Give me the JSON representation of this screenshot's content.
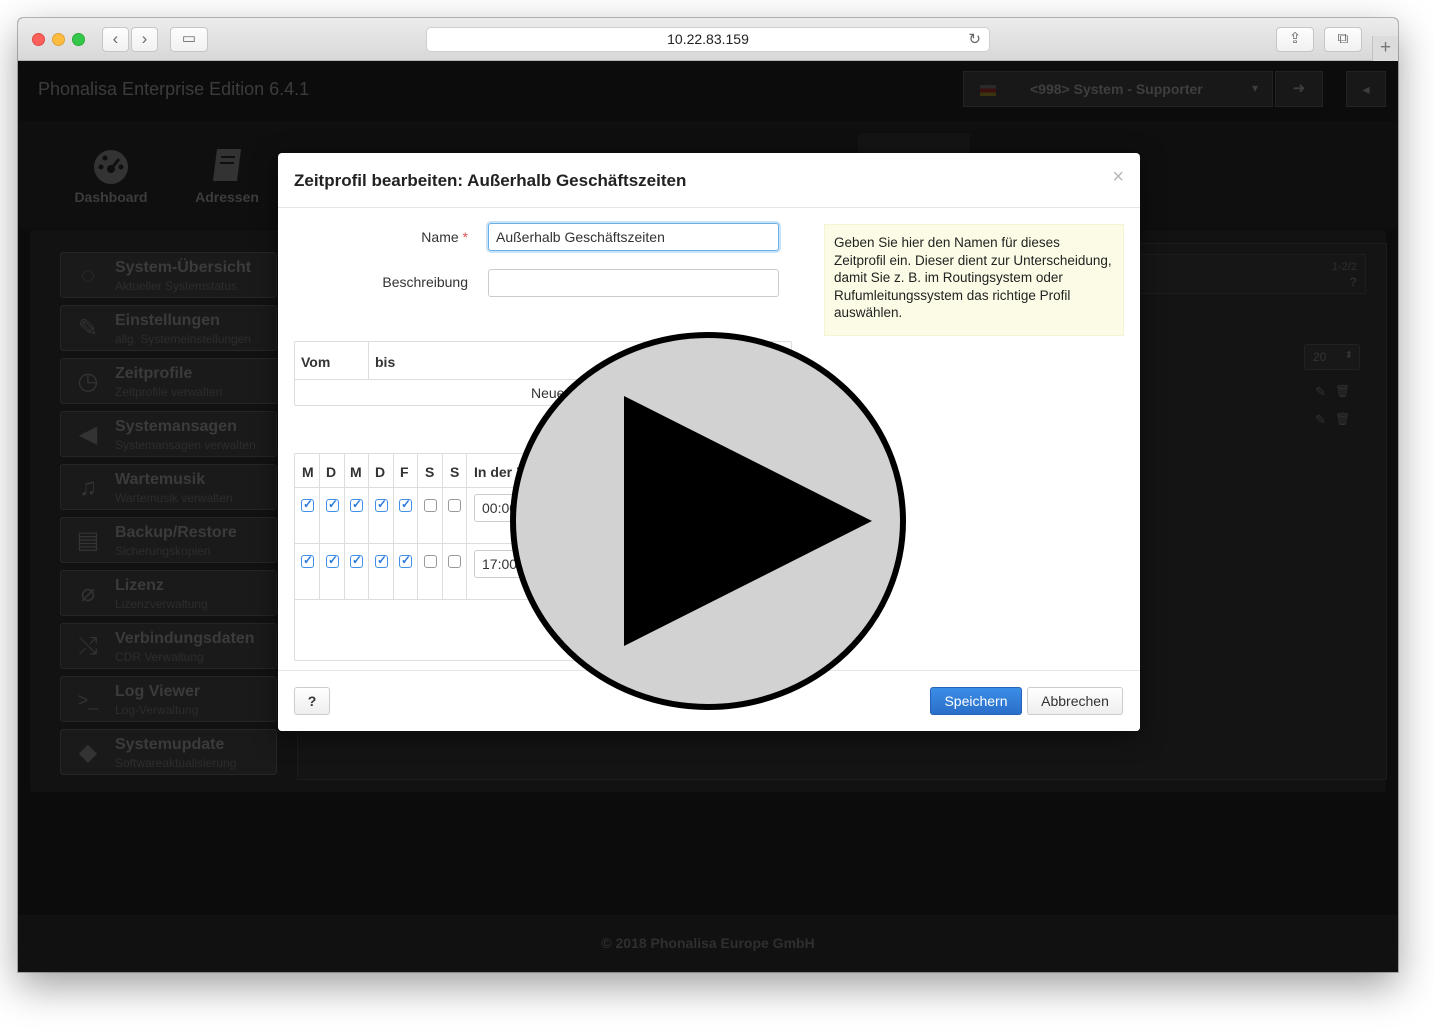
{
  "browser": {
    "url": "10.22.83.159",
    "back_glyph": "‹",
    "forward_glyph": "›",
    "sidebar_glyph": "▭",
    "reload_glyph": "↻",
    "share_glyph": "⇪",
    "tabs_glyph": "⧉",
    "newtab_glyph": "+"
  },
  "app": {
    "title": "Phonalisa Enterprise Edition 6.4.1",
    "user": "<998> System - Supporter",
    "user_caret": "▾",
    "logout_glyph": "➜",
    "collapse_glyph": "◂",
    "footer": "© 2018 Phonalisa Europe GmbH"
  },
  "topnav": [
    {
      "label": "Dashboard",
      "icon": "dashboard-icon"
    },
    {
      "label": "Adressen",
      "icon": "address-book-icon"
    }
  ],
  "sidebar": [
    {
      "title": "System-Übersicht",
      "subtitle": "Aktueller Systemstatus",
      "icon": "lightbulb-icon",
      "glyph": "◌"
    },
    {
      "title": "Einstellungen",
      "subtitle": "allg. Systemeinstellungen",
      "icon": "wrench-icon",
      "glyph": "✎"
    },
    {
      "title": "Zeitprofile",
      "subtitle": "Zeitprofile verwalten",
      "icon": "clock-icon",
      "glyph": "◷"
    },
    {
      "title": "Systemansagen",
      "subtitle": "Systemansagen verwalten",
      "icon": "megaphone-icon",
      "glyph": "◀"
    },
    {
      "title": "Wartemusik",
      "subtitle": "Wartemusik verwalten",
      "icon": "music-icon",
      "glyph": "♫"
    },
    {
      "title": "Backup/Restore",
      "subtitle": "Sicherungskopien",
      "icon": "archive-icon",
      "glyph": "▤"
    },
    {
      "title": "Lizenz",
      "subtitle": "Lizenzverwaltung",
      "icon": "paperclip-icon",
      "glyph": "⌀"
    },
    {
      "title": "Verbindungsdaten",
      "subtitle": "CDR Verwaltung",
      "icon": "shuffle-icon",
      "glyph": "⤭"
    },
    {
      "title": "Log Viewer",
      "subtitle": "Log-Verwaltung",
      "icon": "terminal-icon",
      "glyph": ">_"
    },
    {
      "title": "Systemupdate",
      "subtitle": "Softwareaktualisierung",
      "icon": "tag-icon",
      "glyph": "◆"
    }
  ],
  "background_panel": {
    "pager": "1-2/2",
    "help_glyph": "?",
    "page_size": "20",
    "page_size_caret": "⬍",
    "edit_glyph": "✎",
    "delete_glyph": "🗑"
  },
  "modal": {
    "title": "Zeitprofil bearbeiten: Außerhalb Geschäftszeiten",
    "close_glyph": "×",
    "name_label": "Name",
    "required_mark": "*",
    "name_value": "Außerhalb Geschäftszeiten",
    "description_label": "Beschreibung",
    "description_value": "",
    "hint": "Geben Sie hier den Namen für dieses Zeitprofil ein. Dieser dient zur Unterscheidung, damit Sie z. B. im Routingsystem oder Rufumleitungssystem das richtige Profil auswählen.",
    "date_table": {
      "col_from": "Vom",
      "col_to": "bis",
      "new_row_text": "Neue"
    },
    "weekday_table": {
      "headers": [
        "M",
        "D",
        "M",
        "D",
        "F",
        "S",
        "S"
      ],
      "time_header": "In der Z",
      "rows": [
        {
          "days": [
            true,
            true,
            true,
            true,
            true,
            false,
            false
          ],
          "time": "00:00"
        },
        {
          "days": [
            true,
            true,
            true,
            true,
            true,
            false,
            false
          ],
          "time": "17:00"
        }
      ]
    },
    "help_button": "?",
    "save_button": "Speichern",
    "cancel_button": "Abbrechen"
  },
  "overlay": {
    "icon": "play-icon",
    "fill_color": "#d2d2d2",
    "stroke_color": "#000000"
  }
}
